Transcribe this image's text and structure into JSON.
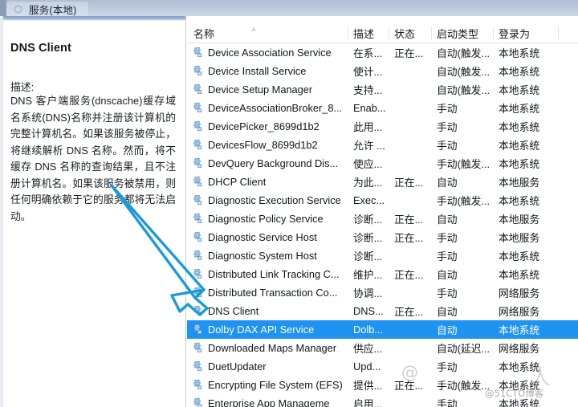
{
  "window": {
    "tab_title": "服务(本地)",
    "tab_icon": "gear-icon"
  },
  "detail_pane": {
    "service_title": "DNS Client",
    "description_label": "描述:",
    "description_text": "DNS 客户端服务(dnscache)缓存域名系统(DNS)名称并注册该计算机的完整计算机名。如果该服务被停止，将继续解析 DNS 名称。然而，将不缓存 DNS 名称的查询结果，且不注册计算机名。如果该服务被禁用，则任何明确依赖于它的服务都将无法启动。"
  },
  "list": {
    "columns": [
      {
        "key": "name",
        "label": "名称",
        "sort_indicator": "ascending-caret-icon"
      },
      {
        "key": "desc",
        "label": "描述"
      },
      {
        "key": "state",
        "label": "状态"
      },
      {
        "key": "start",
        "label": "启动类型"
      },
      {
        "key": "logon",
        "label": "登录为"
      }
    ],
    "selected_index": 15,
    "selection_color": "#1f93f2",
    "rows": [
      {
        "name": "Device Association Service",
        "desc": "在系...",
        "state": "正在...",
        "start": "自动(触发...",
        "logon": "本地系统"
      },
      {
        "name": "Device Install Service",
        "desc": "使计...",
        "state": "",
        "start": "自动(触发...",
        "logon": "本地系统"
      },
      {
        "name": "Device Setup Manager",
        "desc": "支持...",
        "state": "",
        "start": "自动(触发...",
        "logon": "本地系统"
      },
      {
        "name": "DeviceAssociationBroker_8...",
        "desc": "Enab...",
        "state": "",
        "start": "手动",
        "logon": "本地系统"
      },
      {
        "name": "DevicePicker_8699d1b2",
        "desc": "此用...",
        "state": "",
        "start": "手动",
        "logon": "本地系统"
      },
      {
        "name": "DevicesFlow_8699d1b2",
        "desc": "允许 ...",
        "state": "",
        "start": "手动",
        "logon": "本地系统"
      },
      {
        "name": "DevQuery Background Dis...",
        "desc": "使应...",
        "state": "",
        "start": "手动(触发...",
        "logon": "本地系统"
      },
      {
        "name": "DHCP Client",
        "desc": "为此...",
        "state": "正在...",
        "start": "自动",
        "logon": "本地服务"
      },
      {
        "name": "Diagnostic Execution Service",
        "desc": "Exec...",
        "state": "",
        "start": "手动(触发...",
        "logon": "本地系统"
      },
      {
        "name": "Diagnostic Policy Service",
        "desc": "诊断...",
        "state": "正在...",
        "start": "自动",
        "logon": "本地服务"
      },
      {
        "name": "Diagnostic Service Host",
        "desc": "诊断...",
        "state": "正在...",
        "start": "手动",
        "logon": "本地服务"
      },
      {
        "name": "Diagnostic System Host",
        "desc": "诊断...",
        "state": "",
        "start": "手动",
        "logon": "本地系统"
      },
      {
        "name": "Distributed Link Tracking C...",
        "desc": "维护...",
        "state": "正在...",
        "start": "自动",
        "logon": "本地系统"
      },
      {
        "name": "Distributed Transaction Co...",
        "desc": "协调...",
        "state": "",
        "start": "手动",
        "logon": "网络服务"
      },
      {
        "name": "DNS Client",
        "desc": "DNS...",
        "state": "正在...",
        "start": "自动",
        "logon": "网络服务"
      },
      {
        "name": "Dolby DAX API Service",
        "desc": "Dolb...",
        "state": "",
        "start": "自动",
        "logon": "本地系统"
      },
      {
        "name": "Downloaded Maps Manager",
        "desc": "供应...",
        "state": "",
        "start": "自动(延迟...",
        "logon": "网络服务"
      },
      {
        "name": "DuetUpdater",
        "desc": "Upd...",
        "state": "",
        "start": "手动",
        "logon": "本地系统"
      },
      {
        "name": "Encrypting File System (EFS)",
        "desc": "提供...",
        "state": "正在...",
        "start": "手动(触发...",
        "logon": "本地系统"
      },
      {
        "name": "Enterprise App Manageme",
        "desc": "启用...",
        "state": "",
        "start": "手动",
        "logon": "本地系统"
      }
    ]
  },
  "annotation": {
    "type": "hand-drawn-arrow",
    "color": "#1b9ada",
    "points_to": "DNS Client"
  },
  "watermark": {
    "big_text": "@",
    "small_text": "@51CTO博客",
    "stroke_text": "人"
  }
}
